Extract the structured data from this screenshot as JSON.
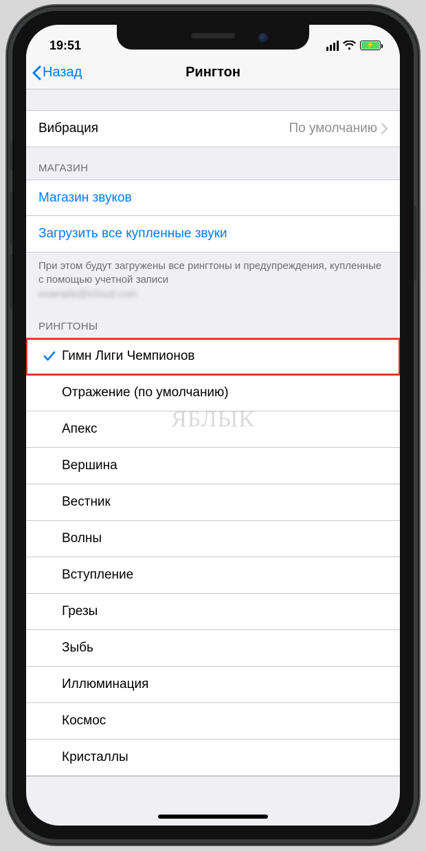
{
  "status": {
    "time": "19:51"
  },
  "nav": {
    "back": "Назад",
    "title": "Рингтон"
  },
  "vibration": {
    "label": "Вибрация",
    "value": "По умолчанию"
  },
  "store": {
    "header": "МАГАЗИН",
    "sound_store": "Магазин звуков",
    "download_all": "Загрузить все купленные звуки",
    "footer_line": "При этом будут загружены все рингтоны и предупреждения, купленные с помощью учетной записи",
    "footer_blur": "example@icloud.com"
  },
  "ringtones": {
    "header": "РИНГТОНЫ",
    "items": [
      {
        "label": "Гимн Лиги Чемпионов",
        "selected": true,
        "highlight": true
      },
      {
        "label": "Отражение (по умолчанию)",
        "selected": false
      },
      {
        "label": "Апекс",
        "selected": false
      },
      {
        "label": "Вершина",
        "selected": false
      },
      {
        "label": "Вестник",
        "selected": false
      },
      {
        "label": "Волны",
        "selected": false
      },
      {
        "label": "Вступление",
        "selected": false
      },
      {
        "label": "Грезы",
        "selected": false
      },
      {
        "label": "Зыбь",
        "selected": false
      },
      {
        "label": "Иллюминация",
        "selected": false
      },
      {
        "label": "Космос",
        "selected": false
      },
      {
        "label": "Кристаллы",
        "selected": false
      }
    ]
  },
  "watermark": "ЯБЛЫК"
}
